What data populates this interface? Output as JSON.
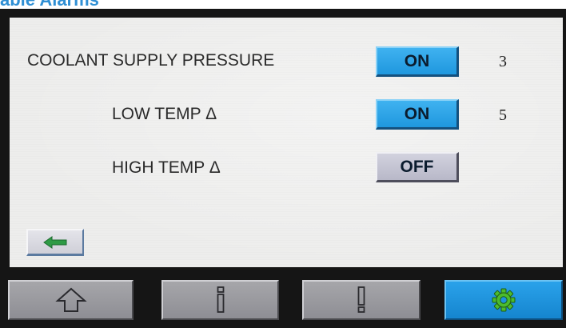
{
  "page": {
    "title": "able Alarms"
  },
  "alarms": [
    {
      "label": "COOLANT SUPPLY PRESSURE",
      "state": "ON",
      "value": "3"
    },
    {
      "label": "LOW TEMP Δ",
      "state": "ON",
      "value": "5"
    },
    {
      "label": "HIGH TEMP Δ",
      "state": "OFF",
      "value": ""
    }
  ],
  "colors": {
    "title": "#2f8fd4",
    "toggle_on": "#2aa6ec",
    "toggle_off": "#c4c4d2",
    "nav_active": "#1d93dc",
    "back_arrow": "#2e9a45",
    "gear": "#4cbb2e"
  },
  "icons": {
    "back": "left-arrow-icon",
    "home": "home-icon",
    "info": "info-icon",
    "alert": "exclamation-icon",
    "settings": "gear-icon"
  },
  "navbar": {
    "items": [
      {
        "name": "home",
        "active": false
      },
      {
        "name": "info",
        "active": false
      },
      {
        "name": "alert",
        "active": false
      },
      {
        "name": "settings",
        "active": true
      }
    ]
  }
}
